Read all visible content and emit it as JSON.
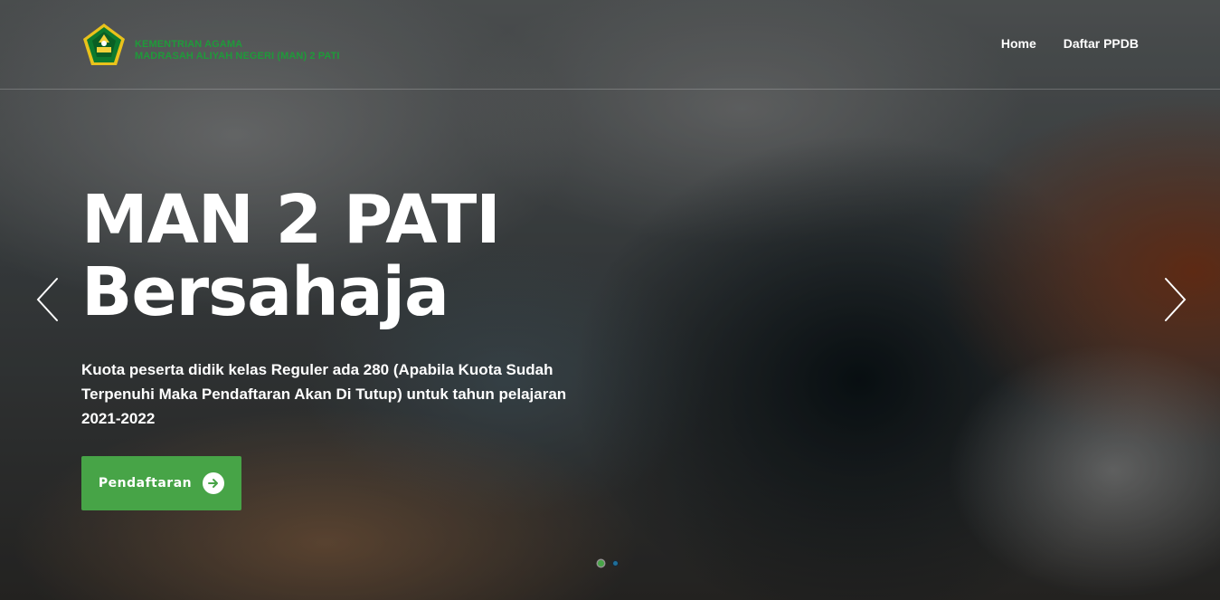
{
  "header": {
    "brand_line1": "KEMENTRIAN AGAMA",
    "brand_line2": "MADRASAH ALIYAH NEGERI (MAN) 2 PATI",
    "logo_icon": "kemenag-emblem-icon",
    "nav": [
      {
        "label": "Home"
      },
      {
        "label": "Daftar PPDB"
      }
    ]
  },
  "hero": {
    "title_line1": "MAN 2 PATI",
    "title_line2": "Bersahaja",
    "description": "Kuota peserta didik kelas Reguler ada 280 (Apabila Kuota Sudah Terpenuhi Maka Pendaftaran Akan Di Tutup) untuk tahun pelajaran 2021-2022",
    "cta_label": "Pendaftaran",
    "cta_icon": "arrow-right-circle-icon"
  },
  "carousel": {
    "prev_icon": "chevron-left-icon",
    "next_icon": "chevron-right-icon",
    "slide_count": 2,
    "active_index": 0
  },
  "colors": {
    "accent_green": "#47a447",
    "brand_green": "#1f9a3a",
    "text": "#ffffff"
  }
}
